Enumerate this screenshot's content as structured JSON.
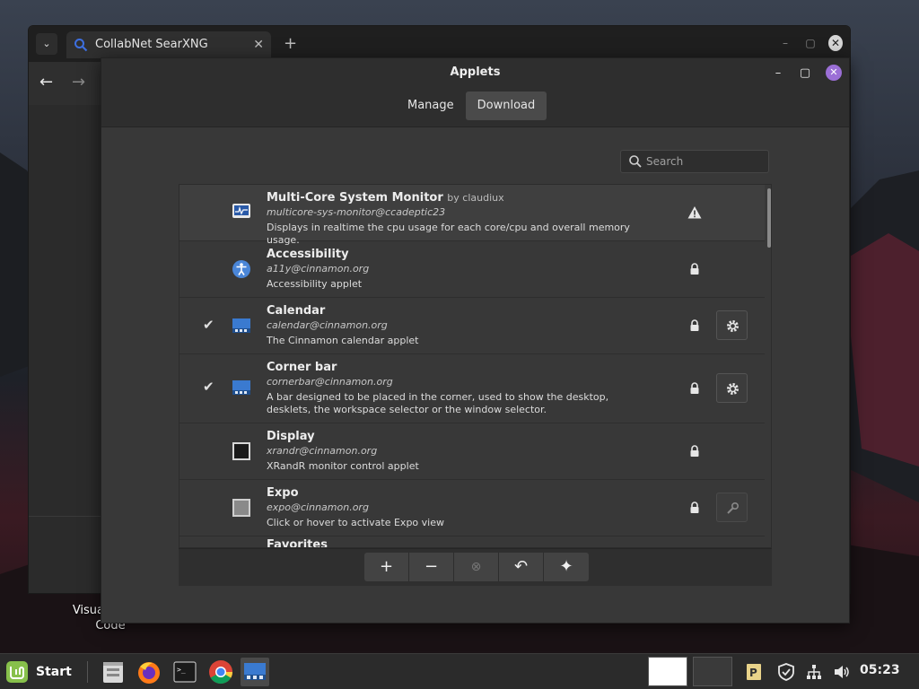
{
  "desktop": {
    "icon_label": "Visual Studio Code"
  },
  "browser": {
    "tab_title": "CollabNet SearXNG",
    "tab_close": "✕",
    "new_tab": "+",
    "minimize": "–",
    "maximize": "▢",
    "close": "✕"
  },
  "applets": {
    "title": "Applets",
    "tabs": [
      {
        "label": "Manage",
        "active": false
      },
      {
        "label": "Download",
        "active": true
      }
    ],
    "search": {
      "placeholder": "Search",
      "value": ""
    },
    "window_controls": {
      "minimize": "–",
      "maximize": "▢",
      "close": "✕"
    },
    "items": [
      {
        "name": "Multi-Core System Monitor",
        "author": "by claudiux",
        "uuid": "multicore-sys-monitor@ccadeptic23",
        "description": "Displays in realtime the cpu usage for each core/cpu and overall memory usage.",
        "checked": false,
        "status_icon": "warning-icon",
        "config": "none"
      },
      {
        "name": "Accessibility",
        "author": "",
        "uuid": "a11y@cinnamon.org",
        "description": "Accessibility applet",
        "checked": false,
        "status_icon": "lock-icon",
        "config": "none"
      },
      {
        "name": "Calendar",
        "author": "",
        "uuid": "calendar@cinnamon.org",
        "description": "The Cinnamon calendar applet",
        "checked": true,
        "status_icon": "lock-icon",
        "config": "settings"
      },
      {
        "name": "Corner bar",
        "author": "",
        "uuid": "cornerbar@cinnamon.org",
        "description": "A bar designed to be placed in the corner, used to show the desktop, desklets, the workspace selector or the window selector.",
        "checked": true,
        "status_icon": "lock-icon",
        "config": "settings"
      },
      {
        "name": "Display",
        "author": "",
        "uuid": "xrandr@cinnamon.org",
        "description": "XRandR monitor control applet",
        "checked": false,
        "status_icon": "lock-icon",
        "config": "none"
      },
      {
        "name": "Expo",
        "author": "",
        "uuid": "expo@cinnamon.org",
        "description": "Click or hover to activate Expo view",
        "checked": false,
        "status_icon": "lock-icon",
        "config": "disabled"
      },
      {
        "name": "Favorites",
        "author": "",
        "uuid": "",
        "description": "",
        "checked": false,
        "status_icon": "",
        "config": "none"
      }
    ],
    "toolbar": {
      "add": "+",
      "remove": "−",
      "uninstall": "⊗",
      "restore": "↶",
      "more": "✦"
    }
  },
  "taskbar": {
    "start_label": "Start",
    "clock": "05:23"
  }
}
